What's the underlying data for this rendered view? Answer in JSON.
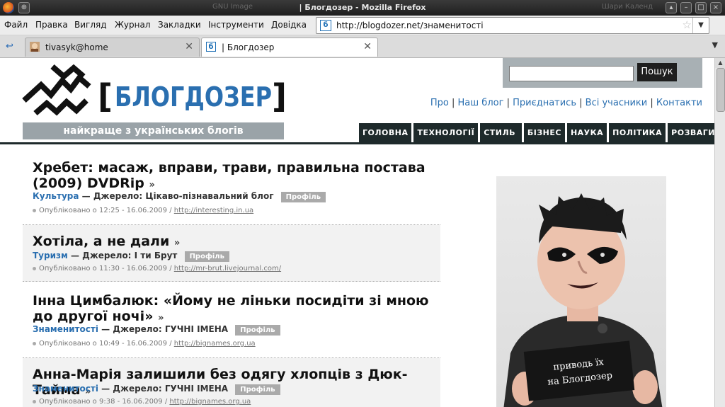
{
  "window": {
    "title": "| Блогдозер - Mozilla Firefox",
    "ghost_left": "GNU Image",
    "ghost_right": "Шари  Календ"
  },
  "menu": {
    "items": [
      "Файл",
      "Правка",
      "Вигляд",
      "Журнал",
      "Закладки",
      "Інструменти",
      "Довідка"
    ]
  },
  "urlbar": {
    "url": "http://blogdozer.net/знаменитості"
  },
  "tabs": [
    {
      "label": "tivasyk@home"
    },
    {
      "label": "| Блогдозер"
    }
  ],
  "site": {
    "logo_text": "[БЛОГДОЗЕР]",
    "tagline": "найкраще з українських блогів",
    "search_button": "Пошук",
    "search_placeholder": "",
    "toplinks": [
      "Про",
      "Наш блог",
      "Приєднатись",
      "Всі учасники",
      "Контакти"
    ],
    "nav": [
      "ГОЛОВНА",
      "ТЕХНОЛОГІЇ",
      "СТИЛЬ ЖИТТЯ",
      "БІЗНЕС",
      "НАУКА",
      "ПОЛІТИКА",
      "РОЗВАГИ"
    ],
    "separator": "|",
    "raquo": "»",
    "source_sep": " — Джерело: ",
    "badge": "Профіль",
    "published": "Опубліковано о "
  },
  "posts": [
    {
      "title": "Хребет: масаж, вправи, трави, правильна постава (2009) DVDRip",
      "category": "Культура",
      "source": "Цікаво-пізнавальний блог",
      "datetime": "12:25 - 16.06.2009 /",
      "link": "http://interesting.in.ua"
    },
    {
      "title": "Хотіла, а не дали",
      "category": "Туризм",
      "source": "І ти Брут",
      "datetime": "11:30 - 16.06.2009 /",
      "link": "http://mr-brut.livejournal.com/"
    },
    {
      "title": "Інна Цимбалюк: «Йому не ліньки посидіти зі мною до другої ночі»",
      "category": "Знаменитості",
      "source": "ГУЧНІ ІМЕНА",
      "datetime": "10:49 - 16.06.2009 /",
      "link": "http://bignames.org.ua"
    },
    {
      "title": "Анна-Марія залишили без одягу хлопців з Дюк-Тайма",
      "category": "Знаменитості",
      "source": "ГУЧНІ ІМЕНА",
      "datetime": "9:38 - 16.06.2009 /",
      "link": "http://bignames.org.ua"
    }
  ],
  "ad": {
    "card_line1": "приводь їх",
    "card_line2": "на Блогдозер"
  }
}
